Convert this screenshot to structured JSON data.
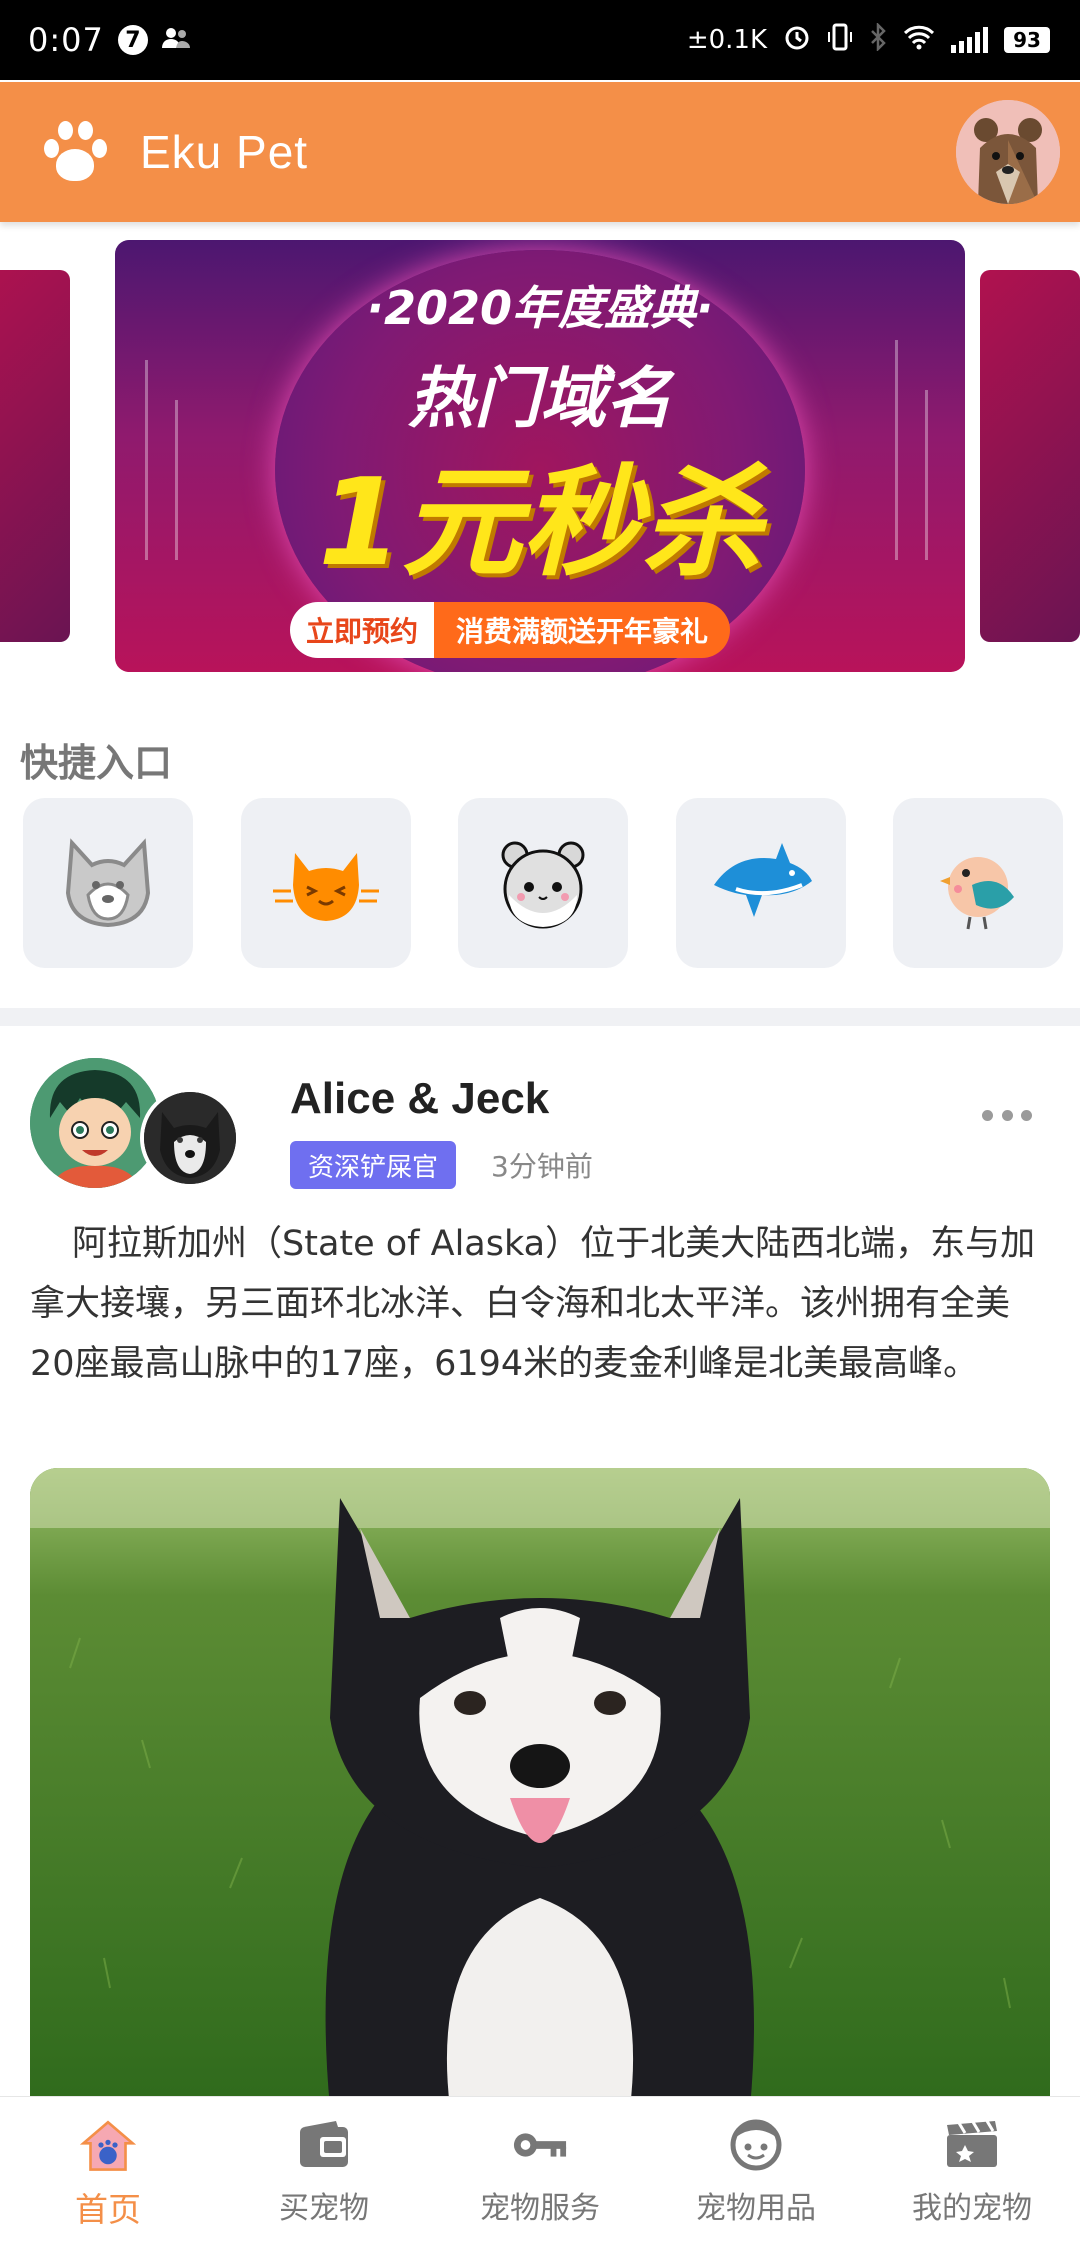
{
  "status_bar": {
    "time": "0:07",
    "notification_badge": "7",
    "network_speed": "±0.1K",
    "battery": "93"
  },
  "app_bar": {
    "title": "Eku Pet",
    "logo_icon": "paw-icon",
    "avatar": "bear-avatar"
  },
  "banner": {
    "line1": "·2020年度盛典·",
    "line2": "热门域名",
    "line3": "1元秒杀",
    "button_left": "立即预约",
    "button_right": "消费满额送开年豪礼"
  },
  "quick_entry": {
    "title": "快捷入口",
    "items": [
      {
        "icon": "husky-icon"
      },
      {
        "icon": "cat-icon"
      },
      {
        "icon": "hamster-icon"
      },
      {
        "icon": "shark-icon"
      },
      {
        "icon": "bird-icon"
      }
    ]
  },
  "post": {
    "author": "Alice & Jeck",
    "tag": "资深铲屎官",
    "time": "3分钟前",
    "text": "阿拉斯加州（State of Alaska）位于北美大陆西北端，东与加拿大接壤，另三面环北冰洋、白令海和北太平洋。该州拥有全美20座最高山脉中的17座，6194米的麦金利峰是北美最高峰。",
    "image": "alaskan-malamute-puppy-photo"
  },
  "bottom_nav": {
    "items": [
      {
        "label": "首页",
        "icon": "home-icon",
        "active": true
      },
      {
        "label": "买宠物",
        "icon": "wallet-icon",
        "active": false
      },
      {
        "label": "宠物服务",
        "icon": "key-icon",
        "active": false
      },
      {
        "label": "宠物用品",
        "icon": "face-icon",
        "active": false
      },
      {
        "label": "我的宠物",
        "icon": "clapper-icon",
        "active": false
      }
    ]
  },
  "colors": {
    "accent": "#f48f48",
    "tag": "#6f6ff0",
    "banner_yellow": "#ffe61a"
  }
}
